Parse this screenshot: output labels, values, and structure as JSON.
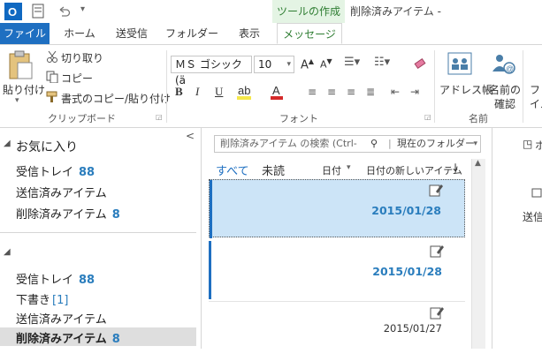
{
  "titlebar": {
    "context_tab": "ツールの作成",
    "window_title": "削除済みアイテム -"
  },
  "tabs": {
    "file": "ファイル",
    "home": "ホーム",
    "send_receive": "送受信",
    "folder": "フォルダー",
    "view": "表示",
    "message": "メッセージ"
  },
  "ribbon": {
    "clipboard": {
      "paste": "貼り付け",
      "cut": "切り取り",
      "copy": "コピー",
      "format_painter": "書式のコピー/貼り付け",
      "group": "クリップボード"
    },
    "font": {
      "font_name": "ＭＳ ゴシック (ä",
      "font_size": "10",
      "group": "フォント"
    },
    "names": {
      "address_book": "アドレス帳",
      "check_names_1": "名前の",
      "check_names_2": "確認",
      "group": "名前"
    },
    "partial": "ファ",
    "partial2": "イル"
  },
  "left_pane": {
    "favorites_header": "お気に入り",
    "favorites": [
      {
        "label": "受信トレイ",
        "count": "88"
      },
      {
        "label": "送信済みアイテム",
        "count": ""
      },
      {
        "label": "削除済みアイテム",
        "count": "8"
      }
    ],
    "folders": [
      {
        "label": "受信トレイ",
        "count": "88"
      },
      {
        "label": "下書き",
        "count": "[1]"
      },
      {
        "label": "送信済みアイテム",
        "count": ""
      },
      {
        "label": "削除済みアイテム",
        "count": "8"
      }
    ]
  },
  "mid_pane": {
    "search_placeholder": "削除済みアイテム の検索 (Ctrl-",
    "search_scope": "現在のフォルダー",
    "filter_all": "すべて",
    "filter_unread": "未読",
    "sort_by": "日付",
    "sort_order": "日付の新しいアイテム",
    "messages": [
      {
        "date": "2015/01/28"
      },
      {
        "date": "2015/01/28"
      },
      {
        "date": "2015/01/27"
      }
    ]
  },
  "right_pane": {
    "top": "ホ",
    "label": "送信"
  },
  "colors": {
    "accent": "#1e6fc1",
    "selected": "#cce4f7",
    "count": "#2a7dbd",
    "context_tab": "#2e7d32"
  }
}
